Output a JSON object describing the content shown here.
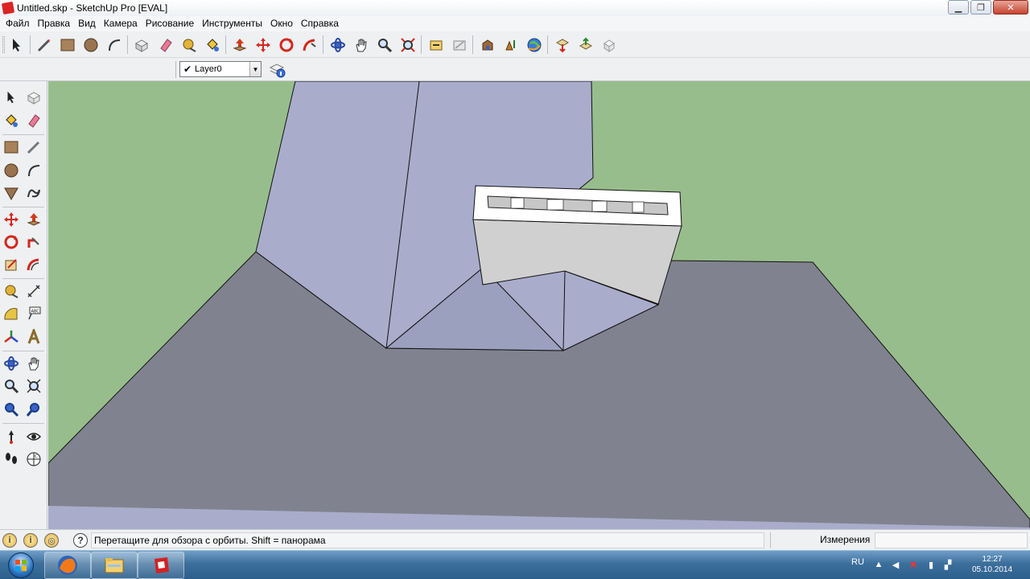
{
  "window": {
    "title": "Untitled.skp - SketchUp Pro [EVAL]",
    "minimize_glyph": "▁",
    "restore_glyph": "❐",
    "close_glyph": "✕"
  },
  "menu": [
    {
      "label": "Файл"
    },
    {
      "label": "Правка"
    },
    {
      "label": "Вид"
    },
    {
      "label": "Камера"
    },
    {
      "label": "Рисование"
    },
    {
      "label": "Инструменты"
    },
    {
      "label": "Окно"
    },
    {
      "label": "Справка"
    }
  ],
  "toolbar": {
    "icons": [
      "select-icon",
      "line-icon",
      "rectangle-icon",
      "circle-icon",
      "arc-icon",
      "make-component-icon",
      "eraser-icon",
      "tape-measure-icon",
      "paint-bucket-icon",
      "push-pull-icon",
      "move-icon",
      "rotate-icon",
      "follow-me-icon",
      "orbit-icon",
      "pan-icon",
      "zoom-icon",
      "zoom-extents-icon",
      "previous-view-icon",
      "next-view-icon",
      "get-models-icon",
      "share-model-icon",
      "google-earth-icon",
      "get-components-icon",
      "share-component-icon",
      "extension-icon"
    ]
  },
  "layers": {
    "current": "Layer0",
    "check": "✔",
    "arrow": "▼"
  },
  "statusbar": {
    "hint": "Перетащите для обзора с орбиты.  Shift = панорама",
    "help": "?",
    "measure_label": "Измерения",
    "measure_value": ""
  },
  "taskbar": {
    "lang": "RU",
    "time": "12:27",
    "date": "05.10.2014"
  },
  "colors": {
    "ground": "#98bd8c",
    "plane_dark": "#80838f",
    "wall": "#a9adcb",
    "face_light": "#d0d0d0",
    "accent_red": "#d22222"
  }
}
